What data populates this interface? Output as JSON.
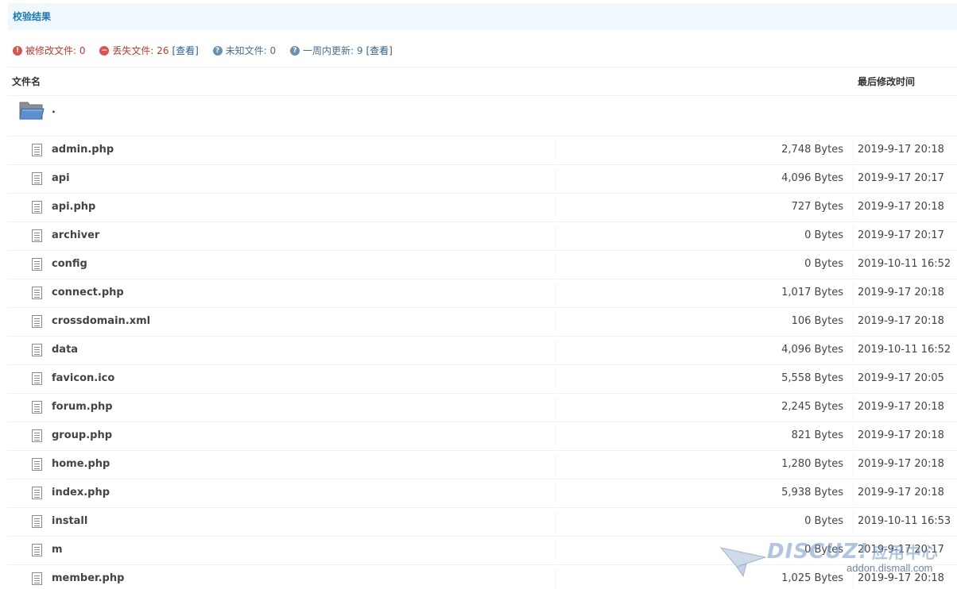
{
  "header": {
    "title": "校验结果"
  },
  "summary": {
    "modified_label": "被修改文件: 0",
    "missing_label": "丢失文件: 26",
    "missing_view": "[查看]",
    "unknown_label": "未知文件: 0",
    "week_label": "一周内更新: 9",
    "week_view": "[查看]"
  },
  "table": {
    "col_name": "文件名",
    "col_date": "最后修改时间",
    "folder_name": ".",
    "rows": [
      {
        "name": "admin.php",
        "size": "2,748 Bytes",
        "date": "2019-9-17 20:18"
      },
      {
        "name": "api",
        "size": "4,096 Bytes",
        "date": "2019-9-17 20:17"
      },
      {
        "name": "api.php",
        "size": "727 Bytes",
        "date": "2019-9-17 20:18"
      },
      {
        "name": "archiver",
        "size": "0 Bytes",
        "date": "2019-9-17 20:17"
      },
      {
        "name": "config",
        "size": "0 Bytes",
        "date": "2019-10-11 16:52"
      },
      {
        "name": "connect.php",
        "size": "1,017 Bytes",
        "date": "2019-9-17 20:18"
      },
      {
        "name": "crossdomain.xml",
        "size": "106 Bytes",
        "date": "2019-9-17 20:18"
      },
      {
        "name": "data",
        "size": "4,096 Bytes",
        "date": "2019-10-11 16:52"
      },
      {
        "name": "favicon.ico",
        "size": "5,558 Bytes",
        "date": "2019-9-17 20:05"
      },
      {
        "name": "forum.php",
        "size": "2,245 Bytes",
        "date": "2019-9-17 20:18"
      },
      {
        "name": "group.php",
        "size": "821 Bytes",
        "date": "2019-9-17 20:18"
      },
      {
        "name": "home.php",
        "size": "1,280 Bytes",
        "date": "2019-9-17 20:18"
      },
      {
        "name": "index.php",
        "size": "5,938 Bytes",
        "date": "2019-9-17 20:18"
      },
      {
        "name": "install",
        "size": "0 Bytes",
        "date": "2019-10-11 16:53"
      },
      {
        "name": "m",
        "size": "0 Bytes",
        "date": "2019-9-17 20:17"
      },
      {
        "name": "member.php",
        "size": "1,025 Bytes",
        "date": "2019-9-17 20:18"
      }
    ]
  },
  "watermark": {
    "logo_text": "DISCUZ!",
    "logo_cn": "应用中心",
    "url": "addon.dismall.com"
  },
  "icons": {
    "modified": "error-circle-icon",
    "missing": "minus-circle-icon",
    "unknown": "question-circle-icon",
    "week": "question-circle-icon",
    "folder": "folder-icon",
    "file": "document-icon"
  },
  "colors": {
    "header_bg": "#f0f7fd",
    "header_text": "#1a7ab5",
    "warn_red": "#c0392b",
    "info_blue": "#4a6e8f"
  }
}
